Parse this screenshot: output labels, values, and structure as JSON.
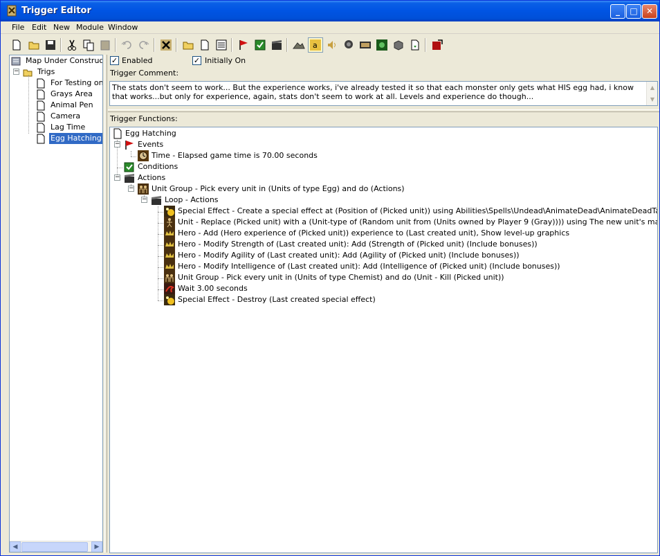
{
  "window": {
    "title": "Trigger Editor"
  },
  "menu": [
    "File",
    "Edit",
    "New",
    "Module",
    "Window"
  ],
  "toolbar": {
    "tools": [
      "new-icon",
      "open-icon",
      "save-icon",
      "cut-icon",
      "copy-icon",
      "paste-icon",
      "undo-icon",
      "redo-icon",
      "delete-icon",
      "new-category-icon",
      "new-trigger-icon",
      "new-comment-icon",
      "new-event-icon",
      "new-condition-icon",
      "new-action-icon",
      "terrain-editor-icon",
      "trigger-editor-icon",
      "sound-editor-icon",
      "object-editor-icon",
      "campaign-editor-icon",
      "ai-editor-icon",
      "object-manager-icon",
      "import-manager-icon",
      "test-map-icon"
    ]
  },
  "left_tree": {
    "root": "Map Under Construction",
    "category": "Trigs",
    "triggers": [
      "For Testing only",
      "Grays Area",
      "Animal Pen",
      "Camera",
      "Lag Time",
      "Egg Hatching"
    ],
    "selected": "Egg Hatching"
  },
  "trigger": {
    "enabled_label": "Enabled",
    "initially_on_label": "Initially On",
    "comment_label": "Trigger Comment:",
    "comment": "The stats don't seem to work... But the experience works, i've already tested it so that each monster only gets what HIS egg had, i know that works...but only for experience, again, stats don't seem to work at all.  Levels and experience do though...",
    "functions_label": "Trigger Functions:",
    "name": "Egg Hatching",
    "events_label": "Events",
    "event": "Time - Elapsed game time is 70.00 seconds",
    "conditions_label": "Conditions",
    "actions_label": "Actions",
    "unit_group_action": "Unit Group - Pick every unit in (Units of type Egg) and do (Actions)",
    "loop_label": "Loop - Actions",
    "loop_actions": [
      "Special Effect - Create a special effect at (Position of (Picked unit)) using Abilities\\Spells\\Undead\\AnimateDead\\AnimateDeadTarget.mdl",
      "Unit - Replace (Picked unit) with a (Unit-type of (Random unit from (Units owned by Player 9 (Gray)))) using The new unit's max life and mana",
      "Hero - Add (Hero experience of (Picked unit)) experience to (Last created unit), Show level-up graphics",
      "Hero - Modify Strength of (Last created unit): Add (Strength of (Picked unit) (Include bonuses))",
      "Hero - Modify Agility of (Last created unit): Add (Agility of (Picked unit) (Include bonuses))",
      "Hero - Modify Intelligence of (Last created unit): Add (Intelligence of (Picked unit) (Include bonuses))",
      "Unit Group - Pick every unit in (Units of type Chemist) and do (Unit - Kill (Picked unit))",
      "Wait 3.00 seconds",
      "Special Effect - Destroy (Last created special effect)"
    ]
  },
  "colors": {
    "title_blue": "#0054e3",
    "selection": "#316ac5",
    "face": "#ece9d8"
  }
}
